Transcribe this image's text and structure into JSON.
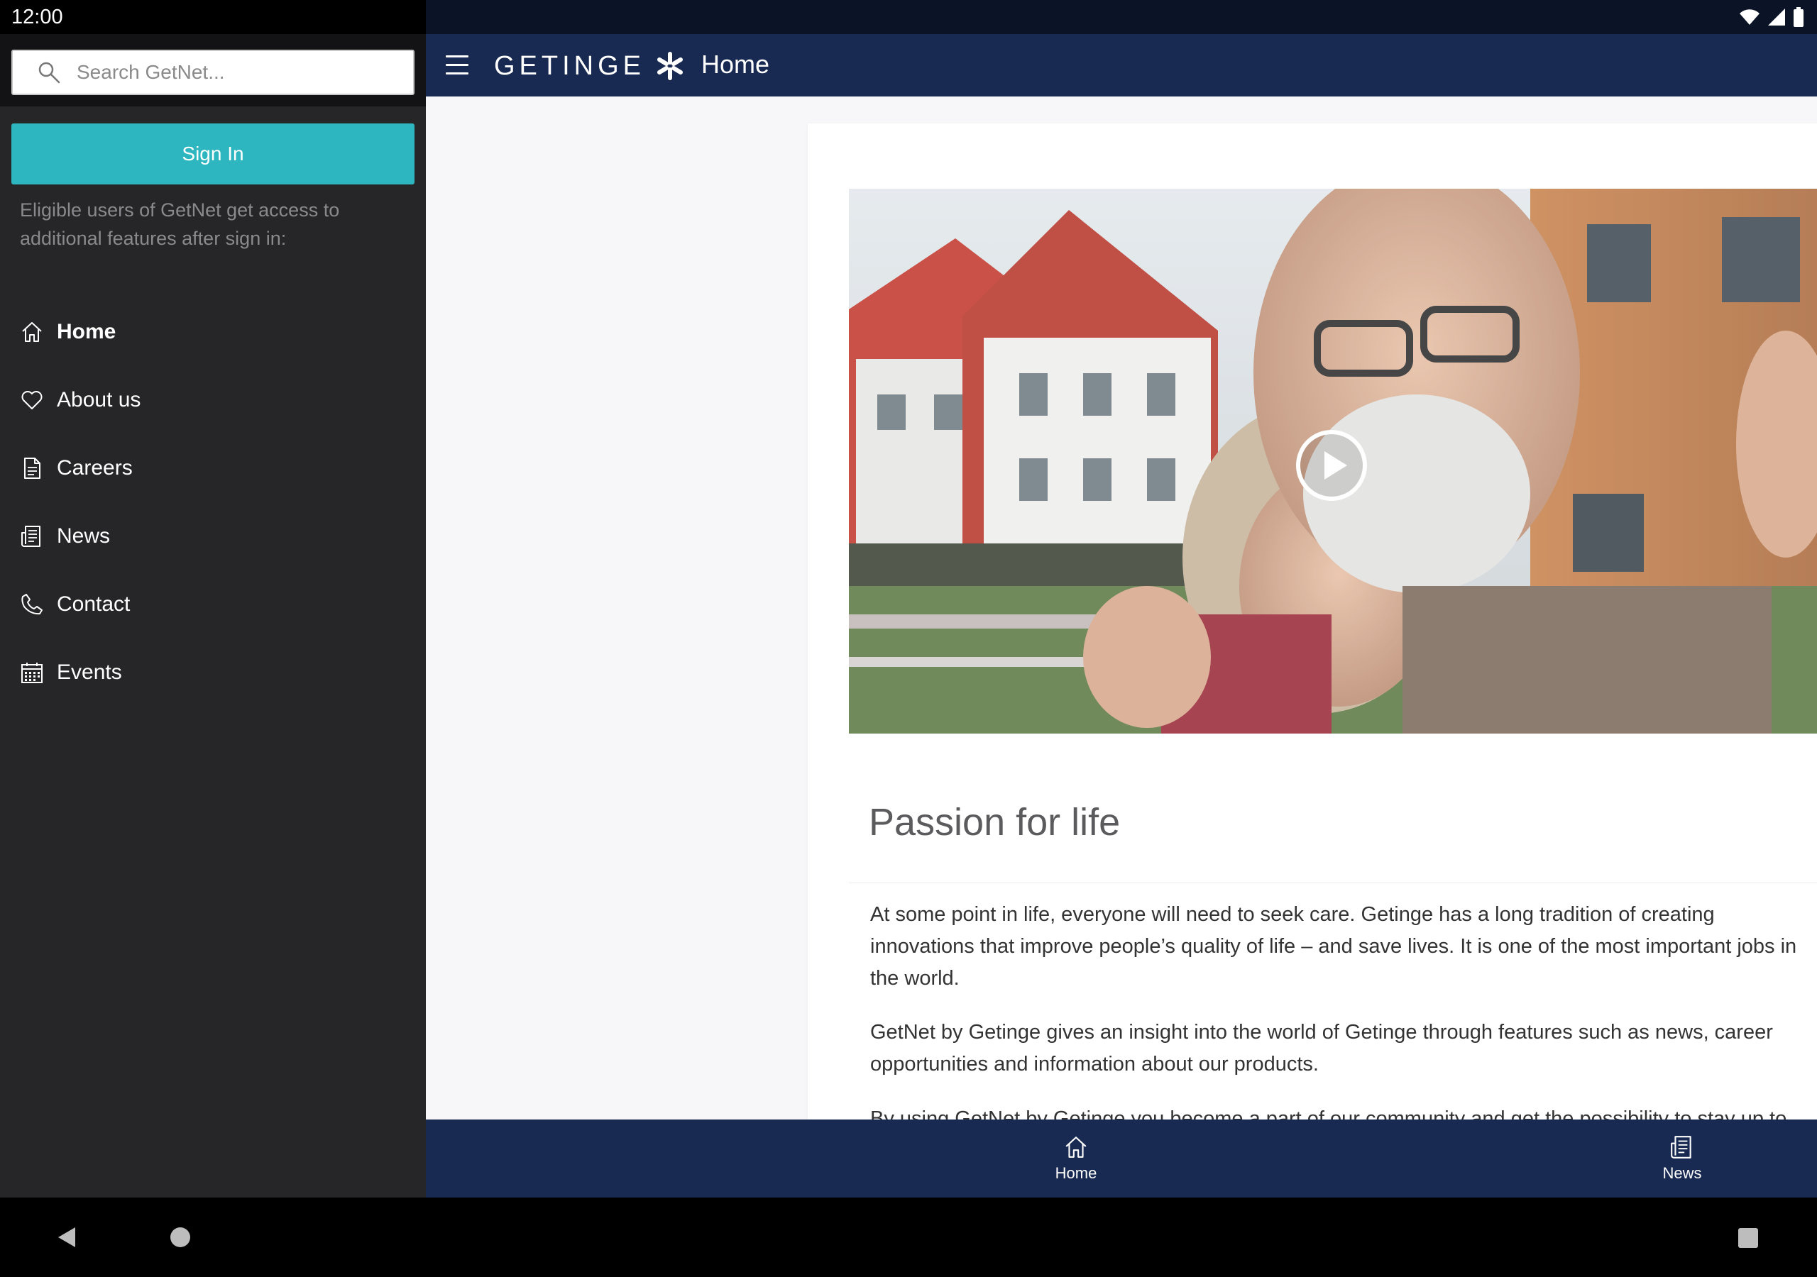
{
  "status_bar": {
    "time": "12:00",
    "icons": [
      "wifi-icon",
      "cell-signal-icon",
      "battery-icon"
    ]
  },
  "drawer": {
    "search": {
      "placeholder": "Search GetNet...",
      "value": ""
    },
    "signin_label": "Sign In",
    "signin_note": "Eligible users of GetNet get access to additional features after sign in:",
    "items": [
      {
        "label": "Home",
        "icon": "home-icon",
        "active": true
      },
      {
        "label": "About us",
        "icon": "heart-icon",
        "active": false
      },
      {
        "label": "Careers",
        "icon": "document-icon",
        "active": false
      },
      {
        "label": "News",
        "icon": "newspaper-icon",
        "active": false
      },
      {
        "label": "Contact",
        "icon": "phone-icon",
        "active": false
      },
      {
        "label": "Events",
        "icon": "calendar-icon",
        "active": false
      }
    ]
  },
  "appbar": {
    "brand": "GETINGE",
    "title": "Home"
  },
  "content": {
    "headline": "Passion for life",
    "paragraphs": [
      "At some point in life, everyone will need to seek care. Getinge has a long tradition of creating innovations that improve people’s quality of life – and save lives. It is one of the most important jobs in the world.",
      "GetNet by Getinge gives an insight into the world of Getinge through features such as news, career opportunities and information about our products.",
      "By using GetNet by Getinge you become a part of our community and get the possibility to stay up to date, no matter who or where you are."
    ]
  },
  "bottom_nav": {
    "items": [
      {
        "label": "Home",
        "icon": "home-icon"
      },
      {
        "label": "News",
        "icon": "newspaper-icon"
      }
    ]
  },
  "colors": {
    "appbar": "#182a52",
    "signin": "#2db6bf",
    "drawer": "#262628"
  }
}
